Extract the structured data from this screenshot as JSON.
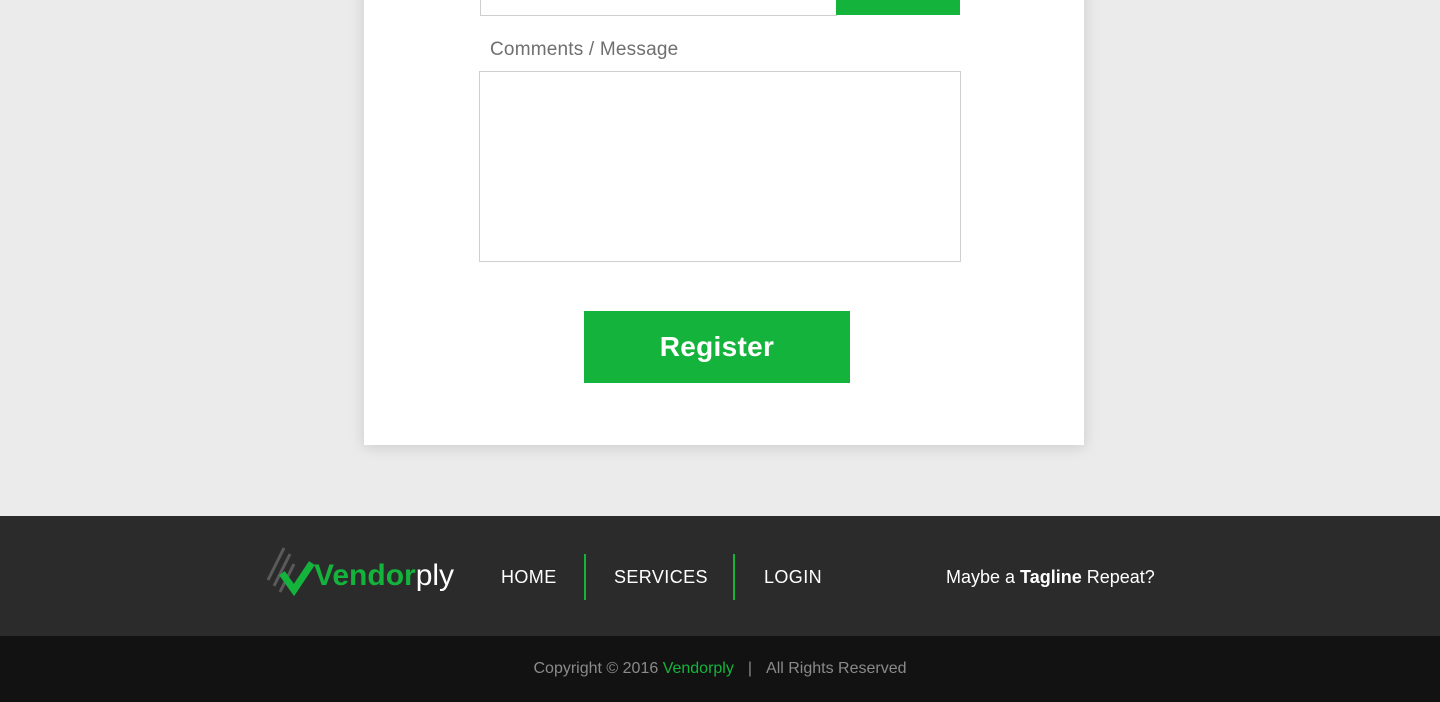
{
  "form": {
    "comments_label": "Comments / Message",
    "comments_value": "",
    "register_label": "Register"
  },
  "footer": {
    "logo": {
      "part_bold": "Vendor",
      "part_light": "ply",
      "icon": "checkmark-stripes-icon"
    },
    "nav": [
      {
        "label": "HOME"
      },
      {
        "label": "SERVICES"
      },
      {
        "label": "LOGIN"
      }
    ],
    "tagline": {
      "prefix": "Maybe a ",
      "bold": "Tagline",
      "suffix": " Repeat?"
    },
    "copyright": {
      "prefix": "Copyright © 2016 ",
      "brand": "Vendorply",
      "separator": "|",
      "rights": "All Rights Reserved"
    }
  },
  "colors": {
    "accent": "#14b43c",
    "page_bg": "#ebebeb",
    "footer_bg": "#2b2b2b",
    "footer_bottom_bg": "#121212"
  }
}
